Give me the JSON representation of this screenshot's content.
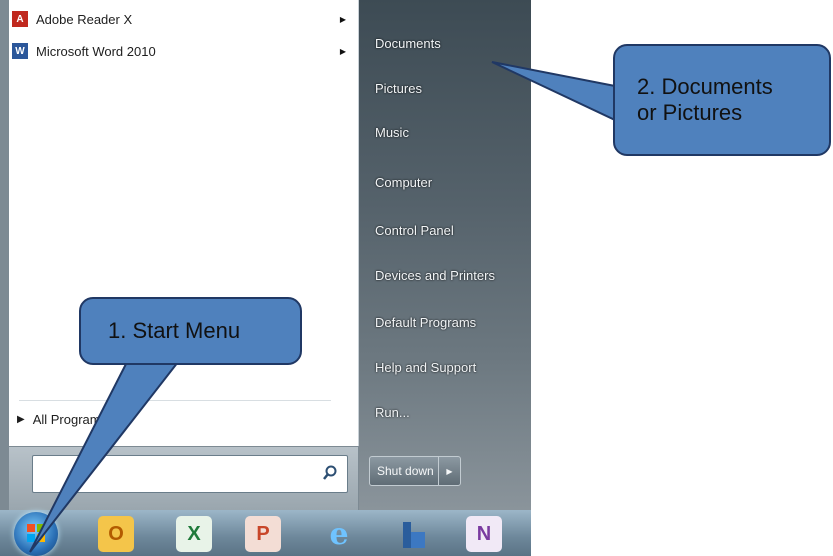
{
  "start_menu": {
    "programs": [
      {
        "label": "Adobe Reader X",
        "icon": "adobe-reader-icon",
        "color": "#c0281e"
      },
      {
        "label": "Microsoft Word 2010",
        "icon": "word-icon",
        "color": "#2b579a"
      }
    ],
    "all_programs_label": "All Programs",
    "search_placeholder": "",
    "places": [
      "Documents",
      "Pictures",
      "Music",
      "Computer",
      "Control Panel",
      "Devices and Printers",
      "Default Programs",
      "Help and Support",
      "Run..."
    ],
    "shutdown_label": "Shut down"
  },
  "taskbar": {
    "icons": [
      {
        "name": "start-orb-icon"
      },
      {
        "name": "outlook-icon",
        "glyph": "O",
        "color": "#e6a21a"
      },
      {
        "name": "excel-icon",
        "glyph": "X",
        "color": "#1f7a3a"
      },
      {
        "name": "powerpoint-icon",
        "glyph": "P",
        "color": "#c8462a"
      },
      {
        "name": "internet-explorer-icon",
        "glyph": "e",
        "color": "#2a8ad8"
      },
      {
        "name": "file-explorer-icon",
        "glyph": "",
        "color": "#2a5d9c"
      },
      {
        "name": "onenote-icon",
        "glyph": "N",
        "color": "#7a3aa0"
      }
    ]
  },
  "callouts": {
    "callout1": "1. Start Menu",
    "callout2_line1": "2. Documents",
    "callout2_line2": "or Pictures"
  },
  "colors": {
    "callout_fill": "#4f81bd",
    "callout_border": "#203864",
    "menu_dark": "#4a5760"
  }
}
